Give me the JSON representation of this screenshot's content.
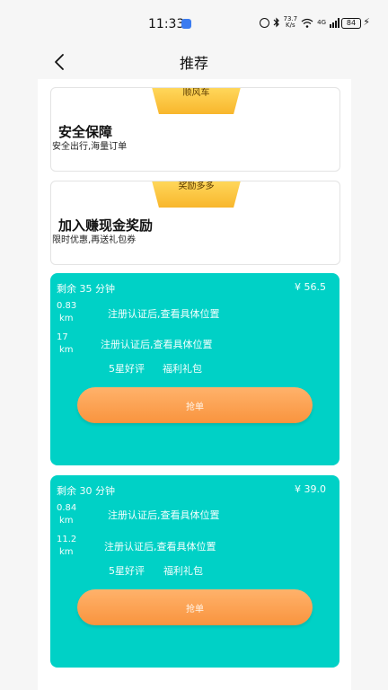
{
  "status_bar": {
    "time": "11:33",
    "speed_top": "73.7",
    "speed_unit": "K/s",
    "network": "4G",
    "battery": "84"
  },
  "nav": {
    "title": "推荐"
  },
  "promos": [
    {
      "tab": "顺风车",
      "title": "安全保障",
      "subtitle": "安全出行,海量订单"
    },
    {
      "tab": "奖励多多",
      "title": "加入赚现金奖励",
      "subtitle": "限时优惠,再送礼包券"
    }
  ],
  "orders": [
    {
      "remaining": "剩余 35 分钟",
      "price": "¥ 56.5",
      "dist1_value": "0.83",
      "dist1_unit": "km",
      "loc1": "注册认证后,查看具体位置",
      "dist2_value": "17",
      "dist2_unit": "km",
      "loc2": "注册认证后,查看具体位置",
      "tag1": "5星好评",
      "tag2": "福利礼包",
      "button": "抢单"
    },
    {
      "remaining": "剩余 30 分钟",
      "price": "¥ 39.0",
      "dist1_value": "0.84",
      "dist1_unit": "km",
      "loc1": "注册认证后,查看具体位置",
      "dist2_value": "11.2",
      "dist2_unit": "km",
      "loc2": "注册认证后,查看具体位置",
      "tag1": "5星好评",
      "tag2": "福利礼包",
      "button": "抢单"
    }
  ],
  "colors": {
    "order_card": "#00d1c6",
    "grab_button": "#f9943e",
    "promo_tab": "#f8b62c",
    "app_badge": "#3b7cf0"
  }
}
